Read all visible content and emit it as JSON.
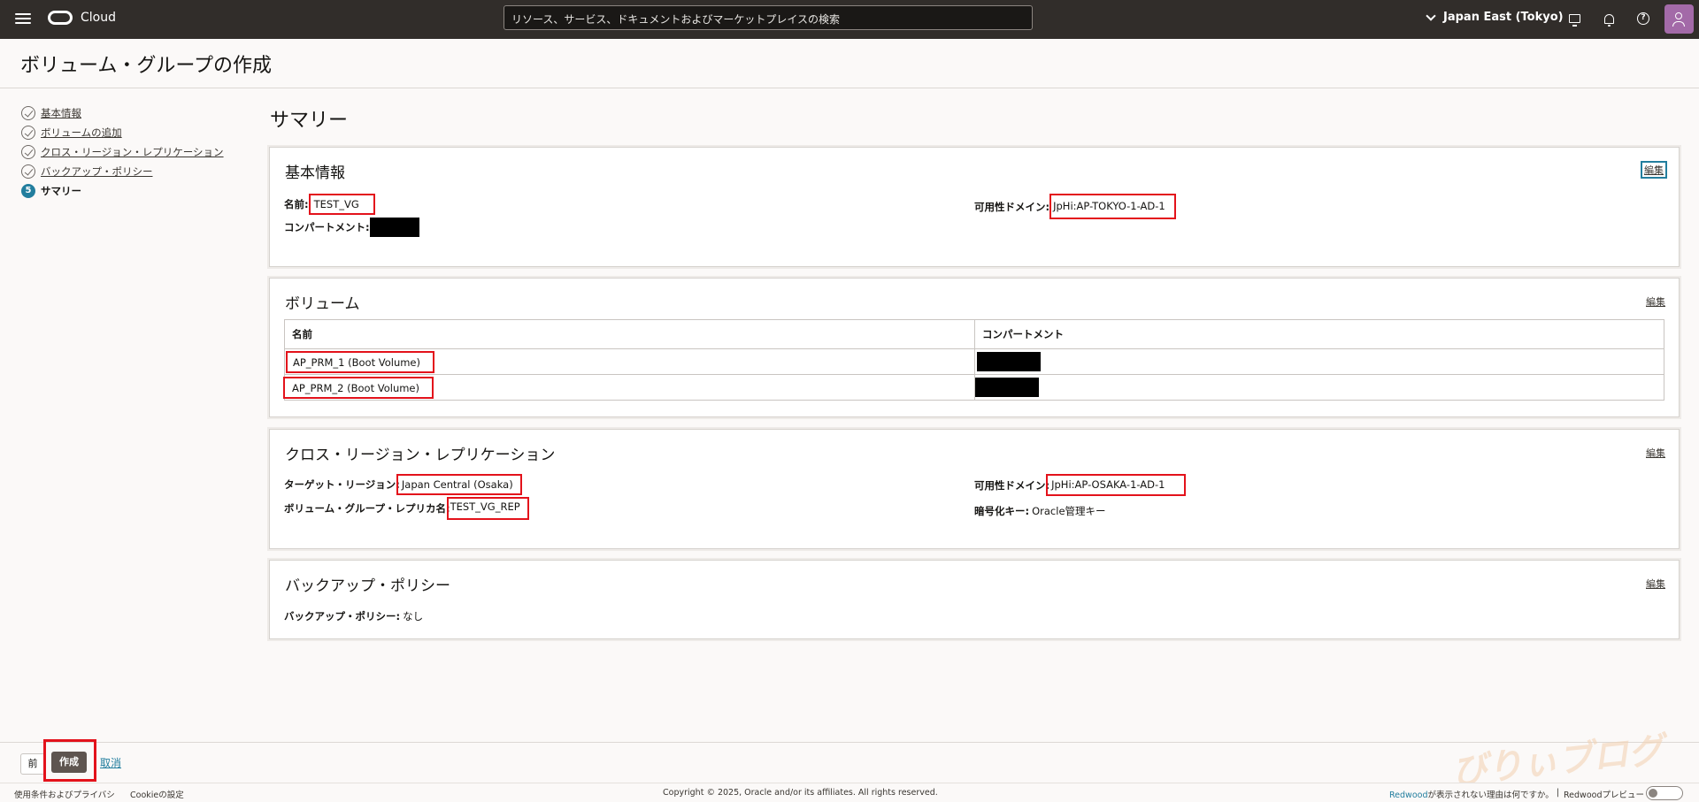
{
  "topbar": {
    "brand": "Cloud",
    "search_placeholder": "リソース、サービス、ドキュメントおよびマーケットプレイスの検索",
    "region": "Japan East (Tokyo)"
  },
  "page": {
    "title": "ボリューム・グループの作成"
  },
  "steps": [
    {
      "label": "基本情報",
      "state": "done"
    },
    {
      "label": "ボリュームの追加",
      "state": "done"
    },
    {
      "label": "クロス・リージョン・レプリケーション",
      "state": "done"
    },
    {
      "label": "バックアップ・ポリシー",
      "state": "done"
    },
    {
      "label": "サマリー",
      "state": "current",
      "number": "5"
    }
  ],
  "summary": {
    "title": "サマリー",
    "basic": {
      "title": "基本情報",
      "edit": "編集",
      "name_label": "名前:",
      "name_value": "TEST_VG",
      "compartment_label": "コンパートメント:",
      "ad_label": "可用性ドメイン:",
      "ad_value": "JpHi:AP-TOKYO-1-AD-1"
    },
    "volumes": {
      "title": "ボリューム",
      "edit": "編集",
      "columns": [
        "名前",
        "コンパートメント"
      ],
      "rows": [
        {
          "name": "AP_PRM_1 (Boot Volume)"
        },
        {
          "name": "AP_PRM_2 (Boot Volume)"
        }
      ]
    },
    "replication": {
      "title": "クロス・リージョン・レプリケーション",
      "edit": "編集",
      "target_region_label": "ターゲット・リージョン:",
      "target_region_value": "Japan Central (Osaka)",
      "replica_name_label": "ボリューム・グループ・レプリカ名:",
      "replica_name_value": "TEST_VG_REP",
      "ad_label": "可用性ドメイン:",
      "ad_value": "JpHi:AP-OSAKA-1-AD-1",
      "encryption_label": "暗号化キー:",
      "encryption_value": "Oracle管理キー"
    },
    "backup": {
      "title": "バックアップ・ポリシー",
      "edit": "編集",
      "policy_label": "バックアップ・ポリシー:",
      "policy_value": "なし"
    }
  },
  "actions": {
    "prev": "前",
    "create": "作成",
    "cancel": "取消"
  },
  "footer": {
    "terms": "使用条件およびプライバシ",
    "cookie": "Cookieの設定",
    "copyright": "Copyright © 2025, Oracle and/or its affiliates. All rights reserved.",
    "redwood_link": "Redwood",
    "redwood_text": "が表示されない理由は何ですか。",
    "separator": "|",
    "redwood_preview": "Redwoodプレビュー"
  },
  "watermark": "びりぃブログ",
  "colors": {
    "topbar": "#312d2a",
    "highlight": "#e3121b",
    "accent": "#227e9e",
    "create_button": "#5e5550",
    "avatar": "#a36aa8"
  }
}
